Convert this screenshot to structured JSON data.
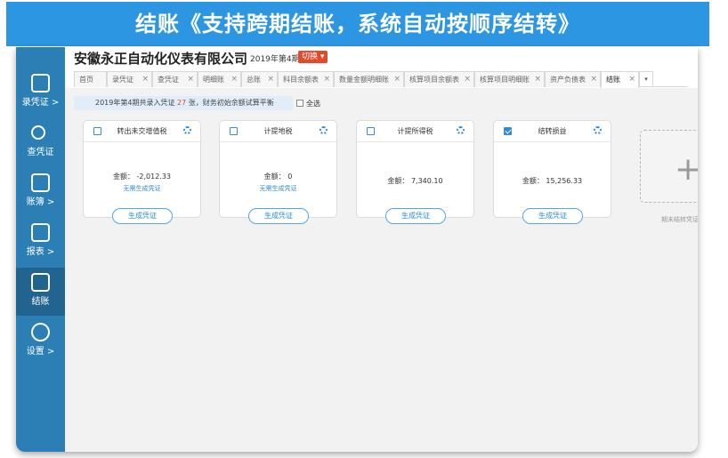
{
  "banner": {
    "title": "结账《支持跨期结账，系统自动按顺序结转》"
  },
  "sidebar": {
    "items": [
      {
        "label": "录凭证",
        "arrow": ">"
      },
      {
        "label": "查凭证",
        "arrow": ""
      },
      {
        "label": "账簿",
        "arrow": ">"
      },
      {
        "label": "报表",
        "arrow": ">"
      },
      {
        "label": "结账",
        "arrow": ""
      },
      {
        "label": "设置",
        "arrow": ">"
      }
    ]
  },
  "header": {
    "company": "安徽永正自动化仪表有限公司",
    "period": "2019年第4期",
    "switch_label": "切换 ▾"
  },
  "tabs": [
    "首页",
    "录凭证",
    "查凭证",
    "明细账",
    "总账",
    "科目余额表",
    "数量金额明细账",
    "核算项目余额表",
    "核算项目明细账",
    "资产负债表",
    "结账"
  ],
  "tab_close": "×",
  "tab_more": "▾",
  "info": {
    "prefix": "2019年第4期共录入凭证",
    "count": "27",
    "suffix": "张，财务初始余额试算平衡"
  },
  "select_all": "全选",
  "cards": [
    {
      "title": "转出未交增值税",
      "amount": "金额： -2,012.33",
      "note": "无需生成凭证",
      "checked": false
    },
    {
      "title": "计提地税",
      "amount": "金额： 0",
      "note": "无需生成凭证",
      "checked": false
    },
    {
      "title": "计提所得税",
      "amount": "金额： 7,340.10",
      "note": "",
      "checked": false
    },
    {
      "title": "结转损益",
      "amount": "金额： 15,256.33",
      "note": "",
      "checked": true
    }
  ],
  "generate_label": "生成凭证",
  "add_card": {
    "plus": "+",
    "label": "期末结转凭证"
  }
}
